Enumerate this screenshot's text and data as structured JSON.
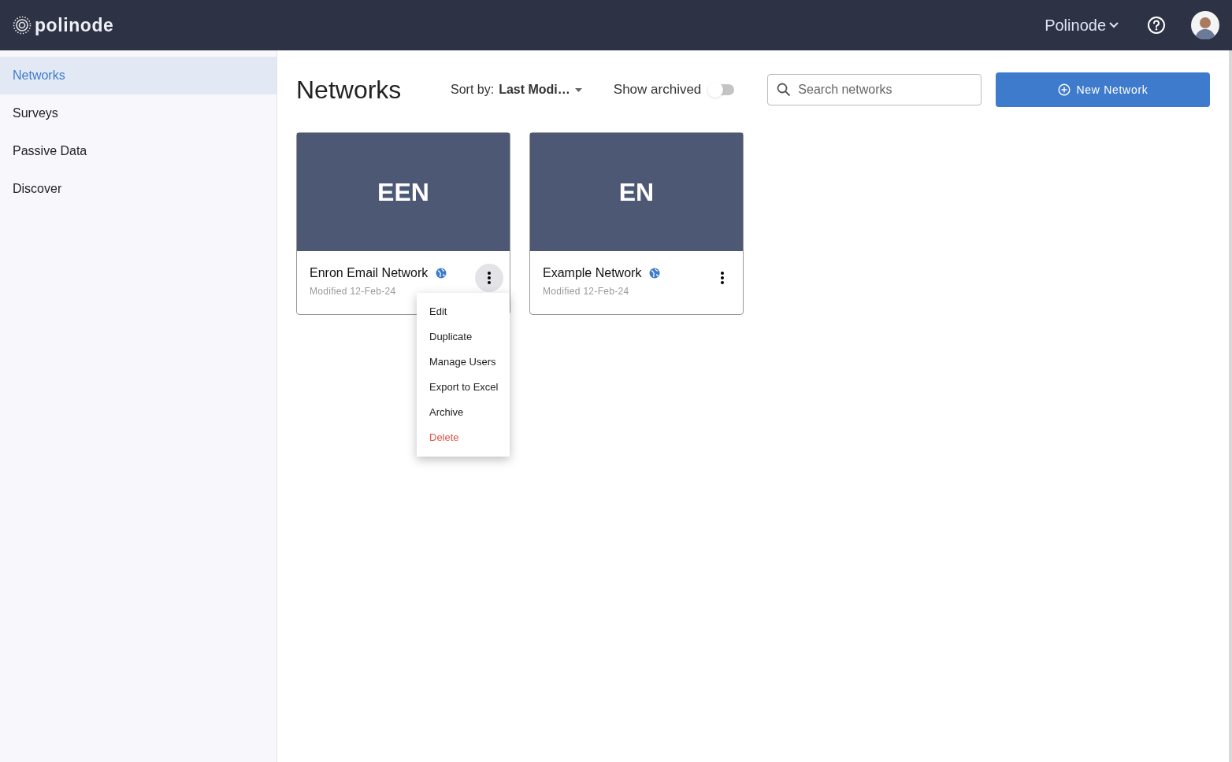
{
  "header": {
    "logo": "polinode",
    "account": "Polinode"
  },
  "sidebar": {
    "items": [
      {
        "label": "Networks",
        "selected": true
      },
      {
        "label": "Surveys",
        "selected": false
      },
      {
        "label": "Passive Data",
        "selected": false
      },
      {
        "label": "Discover",
        "selected": false
      }
    ]
  },
  "toolbar": {
    "title": "Networks",
    "sort_label": "Sort by:",
    "sort_value": "Last Modi…",
    "show_archived_label": "Show archived",
    "show_archived": false,
    "search": {
      "placeholder": "Search networks"
    },
    "new_button": "New Network"
  },
  "networks": [
    {
      "initials": "EEN",
      "name": "Enron Email Network",
      "modified": "Modified 12-Feb-24",
      "menu_open": true
    },
    {
      "initials": "EN",
      "name": "Example Network",
      "modified": "Modified 12-Feb-24",
      "menu_open": false
    }
  ],
  "menu": [
    {
      "label": "Edit",
      "kind": "normal"
    },
    {
      "label": "Duplicate",
      "kind": "normal"
    },
    {
      "label": "Manage Users",
      "kind": "normal"
    },
    {
      "label": "Export to Excel",
      "kind": "normal"
    },
    {
      "label": "Archive",
      "kind": "normal"
    },
    {
      "label": "Delete",
      "kind": "danger"
    }
  ]
}
